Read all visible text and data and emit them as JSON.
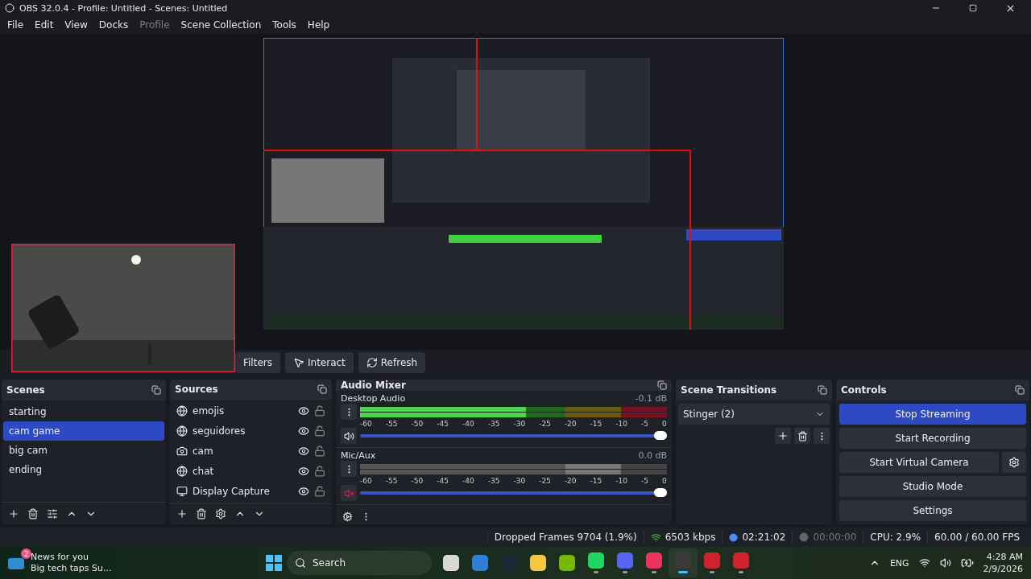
{
  "window": {
    "title": "OBS 32.0.4 - Profile: Untitled - Scenes: Untitled"
  },
  "menu": [
    {
      "label": "File",
      "disabled": false
    },
    {
      "label": "Edit",
      "disabled": false
    },
    {
      "label": "View",
      "disabled": false
    },
    {
      "label": "Docks",
      "disabled": false
    },
    {
      "label": "Profile",
      "disabled": true
    },
    {
      "label": "Scene Collection",
      "disabled": false
    },
    {
      "label": "Tools",
      "disabled": false
    },
    {
      "label": "Help",
      "disabled": false
    }
  ],
  "source_toolbar": [
    {
      "label": "Filters",
      "kind": "plain"
    },
    {
      "label": "Interact",
      "kind": "interact"
    },
    {
      "label": "Refresh",
      "kind": "refresh"
    }
  ],
  "scenes": {
    "title": "Scenes",
    "items": [
      {
        "label": "starting",
        "selected": false
      },
      {
        "label": "cam game",
        "selected": true
      },
      {
        "label": "big cam",
        "selected": false
      },
      {
        "label": "ending",
        "selected": false
      }
    ]
  },
  "sources": {
    "title": "Sources",
    "items": [
      {
        "label": "emojis",
        "kind": "browser",
        "visible": true,
        "locked": false
      },
      {
        "label": "seguidores",
        "kind": "browser",
        "visible": true,
        "locked": false
      },
      {
        "label": "cam",
        "kind": "camera",
        "visible": true,
        "locked": false
      },
      {
        "label": "chat",
        "kind": "browser",
        "visible": true,
        "locked": false
      },
      {
        "label": "Display Capture",
        "kind": "display",
        "visible": true,
        "locked": false
      }
    ]
  },
  "audio_mixer": {
    "title": "Audio Mixer",
    "channels": [
      {
        "name": "Desktop Audio",
        "reading": "-0.1 dB",
        "muted": false,
        "meter": {
          "level": 0.54
        },
        "volume": {
          "level": 1
        },
        "scale": [
          "-60",
          "-55",
          "-50",
          "-45",
          "-40",
          "-35",
          "-30",
          "-25",
          "-20",
          "-15",
          "-10",
          "-5",
          "0"
        ]
      },
      {
        "name": "Mic/Aux",
        "reading": "0.0 dB",
        "muted": true,
        "meter": {
          "level": 0
        },
        "volume": {
          "level": 1
        },
        "scale": [
          "-60",
          "-55",
          "-50",
          "-45",
          "-40",
          "-35",
          "-30",
          "-25",
          "-20",
          "-15",
          "-10",
          "-5",
          "0"
        ]
      }
    ]
  },
  "scene_transitions": {
    "title": "Scene Transitions",
    "value": "Stinger (2)"
  },
  "controls": {
    "title": "Controls",
    "buttons": [
      {
        "label": "Stop Streaming",
        "active": true
      },
      {
        "label": "Start Recording",
        "active": false
      },
      {
        "label": "Start Virtual Camera",
        "active": false
      },
      {
        "label": "Studio Mode",
        "active": false
      },
      {
        "label": "Settings",
        "active": false
      }
    ]
  },
  "status_bar": {
    "dropped_frames": "Dropped Frames 9704 (1.9%)",
    "bitrate": "6503 kbps",
    "stream_time": "02:21:02",
    "record_time": "00:00:00",
    "recording": false,
    "cpu": "CPU: 2.9%",
    "fps": "60.00 / 60.00 FPS"
  },
  "taskbar": {
    "news": {
      "badge": "2",
      "title": "News for you",
      "subtitle": "Big tech taps Su..."
    },
    "search": {
      "label": "Search"
    },
    "apps": [
      {
        "color": "#d8d8d8",
        "running": false,
        "selected": false
      },
      {
        "color": "#2f7fd8",
        "running": false,
        "selected": false
      },
      {
        "color": "#1b2838",
        "running": false,
        "selected": false
      },
      {
        "color": "#f2c744",
        "running": false,
        "selected": false
      },
      {
        "color": "#76b900",
        "running": false,
        "selected": false
      },
      {
        "color": "#1ed760",
        "running": true,
        "selected": false
      },
      {
        "color": "#5865f2",
        "running": true,
        "selected": false
      },
      {
        "color": "#e8335c",
        "running": true,
        "selected": false
      },
      {
        "color": "#3a3a3a",
        "running": true,
        "selected": true
      },
      {
        "color": "#d0222e",
        "running": true,
        "selected": false
      },
      {
        "color": "#d0222e",
        "running": true,
        "selected": false
      }
    ],
    "language": "ENG",
    "time": "4:28 AM",
    "date": "2/9/2026"
  }
}
